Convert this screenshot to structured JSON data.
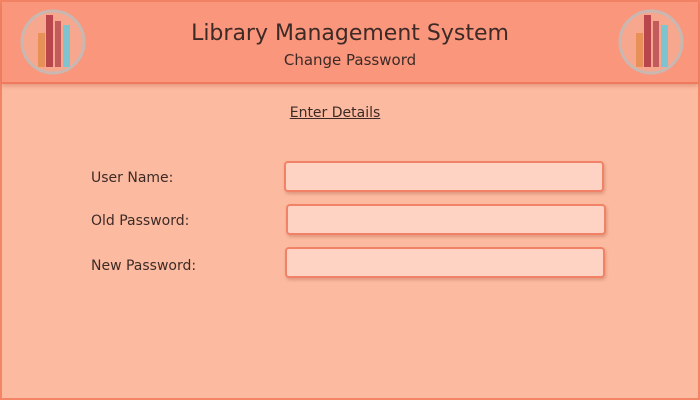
{
  "header": {
    "title": "Library Management System",
    "subtitle": "Change Password",
    "logo_icon": "books-logo-icon"
  },
  "form": {
    "section_title": "Enter Details",
    "fields": [
      {
        "label": "User Name:",
        "value": "",
        "placeholder": ""
      },
      {
        "label": "Old Password:",
        "value": "",
        "placeholder": ""
      },
      {
        "label": "New Password:",
        "value": "",
        "placeholder": ""
      }
    ]
  },
  "colors": {
    "background": "#fcbba0",
    "header": "#f9967c",
    "border": "#f48466",
    "input_fill": "#fed3c4",
    "text": "#3d2a26"
  }
}
